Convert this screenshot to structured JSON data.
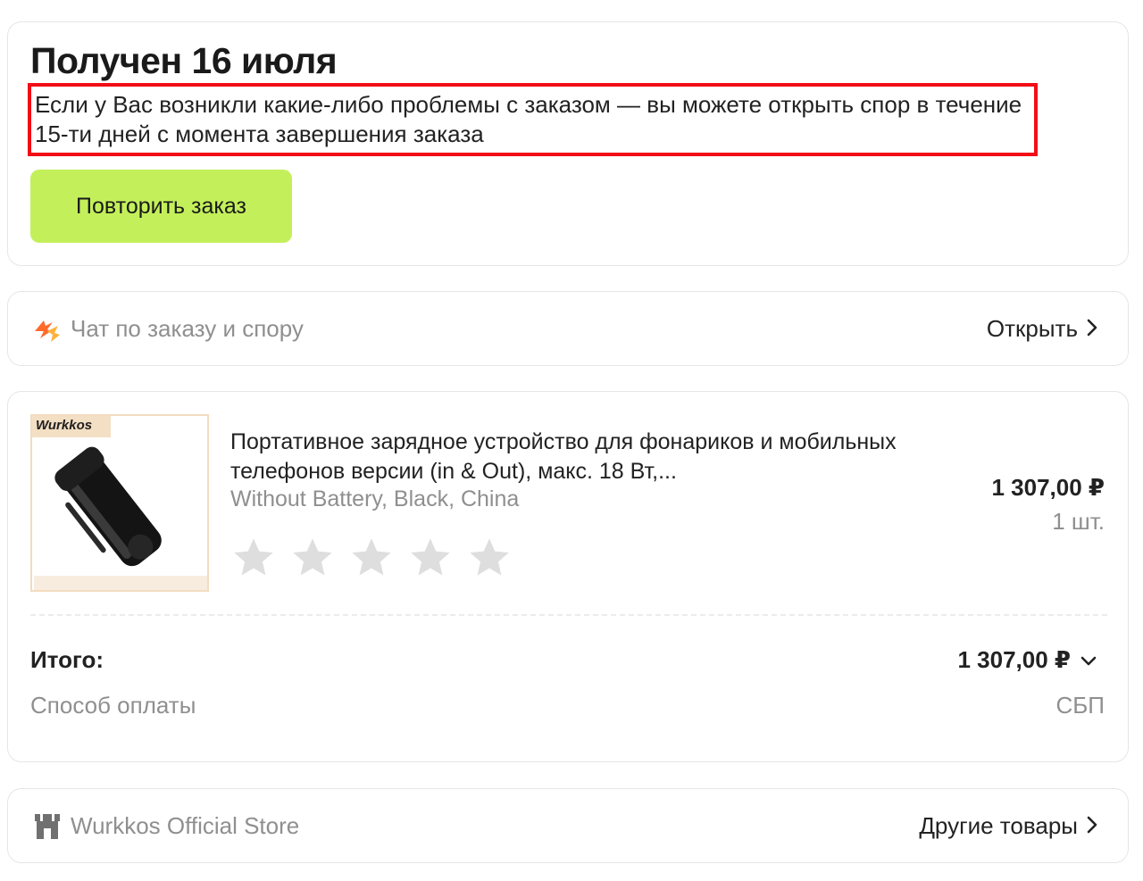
{
  "status": {
    "title": "Получен 16 июля",
    "notice": "Если у Вас возникли какие-либо проблемы с заказом — вы можете открыть спор в течение 15-ти дней с момента завершения заказа",
    "notice_highlight_color": "#f20d17",
    "repeat_button_label": "Повторить заказ",
    "button_color": "#c3f05a"
  },
  "chat": {
    "icon": "chat-flash-icon",
    "label": "Чат по заказу и спору",
    "action_label": "Открыть",
    "accent_color": "#ff6a2b"
  },
  "product": {
    "image_brand": "Wurkkos",
    "title": "Портативное зарядное устройство для фонариков и мобильных телефонов версии (in & Out), макс. 18 Вт,...",
    "variant": "Without Battery, Black, China",
    "price": "1 307,00 ₽",
    "quantity": "1 шт.",
    "rating_stars_total": 5,
    "rating_stars_filled": 0
  },
  "summary": {
    "total_label": "Итого:",
    "total_value": "1 307,00 ₽",
    "payment_label": "Способ оплаты",
    "payment_value": "СБП"
  },
  "store": {
    "icon": "store-icon",
    "name": "Wurkkos Official Store",
    "action_label": "Другие товары"
  }
}
